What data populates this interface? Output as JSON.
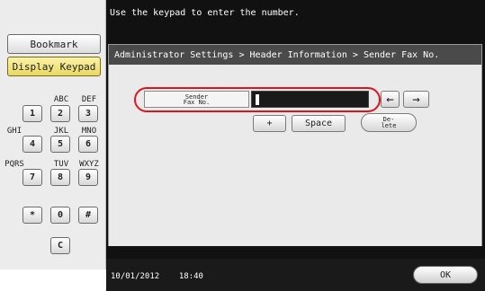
{
  "message": "Use the keypad to enter the number.",
  "sidebar": {
    "bookmark_label": "Bookmark",
    "display_keypad_label": "Display Keypad"
  },
  "keypad": {
    "letters": {
      "k2": "ABC",
      "k3": "DEF",
      "k4": "GHI",
      "k5": "JKL",
      "k6": "MNO",
      "k7": "PQRS",
      "k8": "TUV",
      "k9": "WXYZ"
    },
    "keys": {
      "k1": "1",
      "k2": "2",
      "k3": "3",
      "k4": "4",
      "k5": "5",
      "k6": "6",
      "k7": "7",
      "k8": "8",
      "k9": "9",
      "star": "*",
      "k0": "0",
      "hash": "#",
      "clear": "C"
    }
  },
  "breadcrumb": "Administrator Settings > Header Information > Sender Fax No.",
  "field": {
    "label_line1": "Sender",
    "label_line2": "Fax No.",
    "value": ""
  },
  "controls": {
    "left_arrow": "←",
    "right_arrow": "→",
    "plus": "+",
    "space": "Space",
    "delete_line1": "De-",
    "delete_line2": "lete"
  },
  "status": {
    "date": "10/01/2012",
    "time": "18:40"
  },
  "ok_label": "OK",
  "icons": {
    "left": "left-arrow-icon",
    "right": "right-arrow-icon"
  }
}
